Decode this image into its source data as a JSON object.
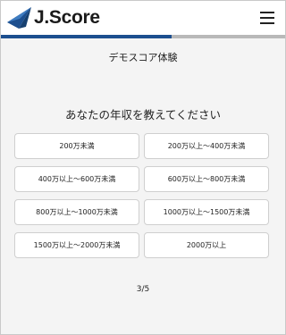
{
  "header": {
    "logo_text": "J.Score",
    "menu_icon": "hamburger-menu-icon",
    "logo_icon": "j-score-logo-icon"
  },
  "progress": {
    "value": 0.6,
    "fill_color": "#1d4f8f",
    "track_color": "#b9b9b9"
  },
  "main": {
    "subtitle": "デモスコア体験",
    "question": "あなたの年収を教えてください",
    "options": [
      "200万未満",
      "200万以上～400万未満",
      "400万以上～600万未満",
      "600万以上～800万未満",
      "800万以上～1000万未満",
      "1000万以上～1500万未満",
      "1500万以上～2000万未満",
      "2000万以上"
    ],
    "pager": "3/5"
  }
}
